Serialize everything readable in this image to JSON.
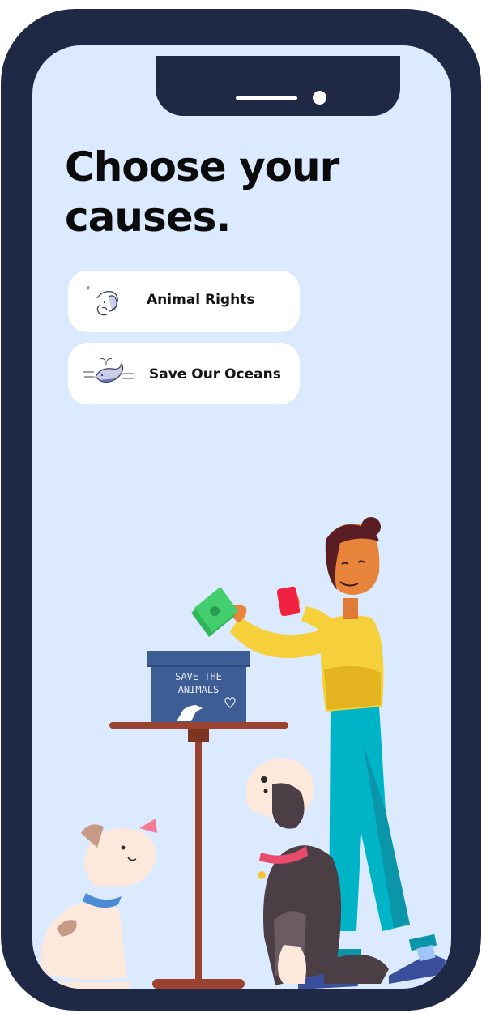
{
  "screen": {
    "title": "Choose your causes."
  },
  "causes": [
    {
      "label": "Animal Rights",
      "icon": "pet-icon"
    },
    {
      "label": "Save Our Oceans",
      "icon": "whale-icon"
    }
  ],
  "illustration": {
    "donation_box_text": "SAVE THE ANIMALS",
    "donation_box_line1": "SAVE THE",
    "donation_box_line2": "ANIMALS"
  },
  "colors": {
    "phone_frame": "#1f2945",
    "screen_background": "#dbeafe",
    "card_background": "#ffffff",
    "title_text": "#0b0b0b"
  }
}
